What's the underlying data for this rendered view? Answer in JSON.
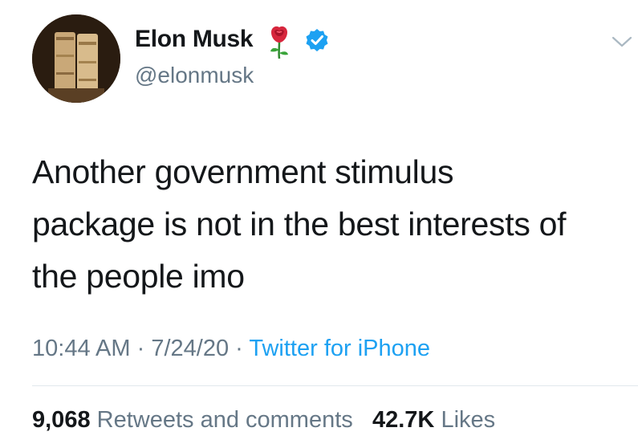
{
  "author": {
    "display_name": "Elon Musk",
    "handle": "@elonmusk",
    "badges": [
      "rose-emoji",
      "verified-icon"
    ],
    "verified_color": "#1da1f2"
  },
  "tweet": {
    "text_lines": [
      "Another government stimulus",
      "package is not in the best interests of",
      "the people imo"
    ],
    "time": "10:44 AM",
    "separator": "·",
    "date": "7/24/20",
    "source": "Twitter for iPhone"
  },
  "stats": {
    "retweets_count": "9,068",
    "retweets_label": "Retweets and comments",
    "likes_count": "42.7K",
    "likes_label": "Likes"
  },
  "icons": {
    "menu": "chevron-down-icon"
  },
  "colors": {
    "text": "#14171a",
    "secondary": "#657786",
    "link": "#1da1f2",
    "divider": "#e1e8ed"
  }
}
